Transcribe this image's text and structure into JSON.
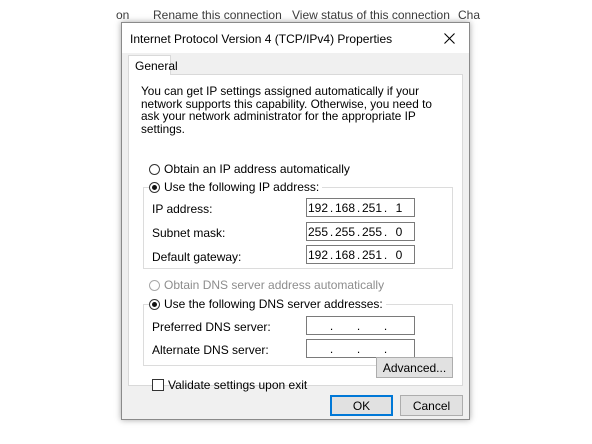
{
  "background_window": {
    "links": [
      "on",
      "Rename this connection",
      "View status of this connection",
      "Cha"
    ]
  },
  "dialog": {
    "title": "Internet Protocol Version 4 (TCP/IPv4) Properties",
    "close_glyph": "✕"
  },
  "tab": {
    "label": "General"
  },
  "description": "You can get IP settings assigned automatically if your network supports this capability. Otherwise, you need to ask your network administrator for the appropriate IP settings.",
  "ip": {
    "auto_label": "Obtain an IP address automatically",
    "manual_label": "Use the following IP address:",
    "selected": "manual",
    "fields": [
      {
        "label": "IP address:",
        "octets": [
          "192",
          "168",
          "251",
          "1"
        ]
      },
      {
        "label": "Subnet mask:",
        "octets": [
          "255",
          "255",
          "255",
          "0"
        ]
      },
      {
        "label": "Default gateway:",
        "octets": [
          "192",
          "168",
          "251",
          "0"
        ]
      }
    ]
  },
  "dns": {
    "auto_label": "Obtain DNS server address automatically",
    "manual_label": "Use the following DNS server addresses:",
    "selected": "manual",
    "fields": [
      {
        "label": "Preferred DNS server:",
        "octets": [
          "",
          "",
          "",
          ""
        ]
      },
      {
        "label": "Alternate DNS server:",
        "octets": [
          "",
          "",
          "",
          ""
        ]
      }
    ]
  },
  "validate": {
    "label": "Validate settings upon exit",
    "checked": false
  },
  "buttons": {
    "advanced": "Advanced...",
    "ok": "OK",
    "cancel": "Cancel"
  },
  "colors": {
    "accent": "#0078d7",
    "dialog_bg": "#f0f0f0",
    "panel_bg": "#ffffff"
  }
}
